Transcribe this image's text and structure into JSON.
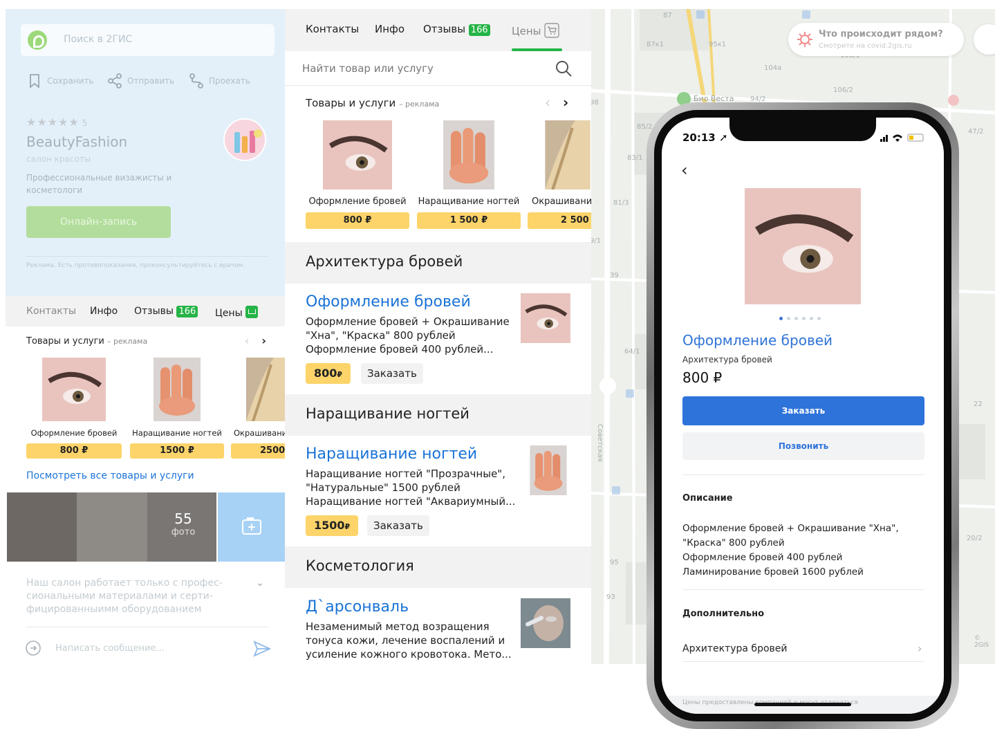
{
  "colors": {
    "green": "#25b447",
    "link_blue": "#1a73d6",
    "price_yellow": "#fcd46a",
    "primary_button": "#2e73da"
  },
  "left_panel": {
    "search_placeholder": "Поиск в 2ГИС",
    "actions": {
      "save": "Сохранить",
      "send": "Отправить",
      "route": "Проехать"
    },
    "rating_stars": "★★★★★",
    "rating_value": "5",
    "business_name": "BeautyFashion",
    "business_type": "салон красоты",
    "business_desc": "Профессиональные визажисты и косметологи",
    "online_button": "Онлайн-запись",
    "disclaimer": "Реклама. Есть противопоказания, проконсультируйтесь с врачом.",
    "tabs": {
      "contacts": "Контакты",
      "info": "Инфо",
      "reviews": "Отзывы",
      "reviews_count": "166",
      "prices": "Цены"
    },
    "goods_heading": "Товары и услуги",
    "goods_ad": "– реклама",
    "products": [
      {
        "label": "Оформление бровей",
        "price": "800 ₽"
      },
      {
        "label": "Наращивание ногтей",
        "price": "1500 ₽"
      },
      {
        "label": "Окрашивание",
        "price": "2500"
      }
    ],
    "all_link": "Посмотреть все товары и услуги",
    "photos_count": "55",
    "photos_word": "фото",
    "about_text": "Наш салон работает только с профес-сиональными материалами и серти-фицированныимм оборудованием",
    "message_placeholder": "Написать сообщение..."
  },
  "mid_panel": {
    "tabs": {
      "contacts": "Контакты",
      "info": "Инфо",
      "reviews": "Отзывы",
      "reviews_count": "166",
      "prices": "Цены"
    },
    "search_placeholder": "Найти товар или услугу",
    "goods_heading": "Товары и услуги",
    "goods_ad": "– реклама",
    "products": [
      {
        "label": "Оформление бровей",
        "price": "800 ₽"
      },
      {
        "label": "Наращивание ногтей",
        "price": "1 500 ₽"
      },
      {
        "label": "Окрашивание",
        "price": "2 500"
      }
    ],
    "sections": [
      {
        "heading": "Архитектура бровей",
        "title": "Оформление бровей",
        "desc": [
          "Оформление бровей + Окрашивание",
          "\"Хна\", \"Краска\" 800 рублей",
          "Оформление бровей 400 рублей..."
        ],
        "price": "800",
        "currency": "₽",
        "order": "Заказать"
      },
      {
        "heading": "Наращивание ногтей",
        "title": "Наращивание ногтей",
        "desc": [
          "Наращивание ногтей \"Прозрачные\",",
          "\"Натуральные\" 1500 рублей",
          "Наращивание ногтей \"Аквариумный..."
        ],
        "price": "1500",
        "currency": "₽",
        "order": "Заказать"
      },
      {
        "heading": "Косметология",
        "title": "Д`арсонваль",
        "desc": [
          "Незаменимый метод возращения",
          "тонуса кожи, лечение воспалений и",
          "усиление кожного кровотока. Мето..."
        ]
      }
    ]
  },
  "map": {
    "covid_title": "Что происходит рядом?",
    "covid_sub": "Смотрите на covid.2gis.ru",
    "poi": "Био Веста",
    "street": "Советская",
    "copyright": "© 2GIS",
    "house_numbers": [
      "87",
      "87к1",
      "95к1",
      "104а",
      "106/2",
      "100/1",
      "85/2",
      "83/1",
      "81/3",
      "94/2",
      "47/2",
      "39",
      "64/1",
      "95",
      "93",
      "22",
      "20/2",
      "98",
      "9/1"
    ]
  },
  "phone": {
    "time": "20:13",
    "title": "Оформление бровей",
    "category": "Архитектура бровей",
    "price": "800 ₽",
    "order_button": "Заказать",
    "call_button": "Позвонить",
    "desc_heading": "Описание",
    "desc_lines": [
      "Оформление бровей + Окрашивание \"Хна\",",
      "\"Краска\" 800 рублей",
      "Оформление бровей 400 рублей",
      "Ламинирование бровей 1600 рублей"
    ],
    "extra_heading": "Дополнительно",
    "extra_item": "Архитектура бровей",
    "footnote": "Цены предоставлены компанией и могут отличаться"
  }
}
